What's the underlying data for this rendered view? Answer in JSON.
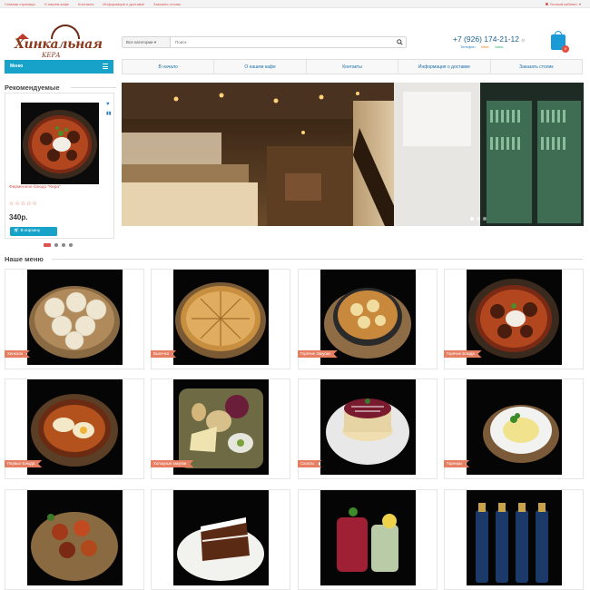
{
  "topbar": {
    "links": [
      "Главная страница",
      "О нашем кафе",
      "Контакты",
      "Информация о доставке",
      "Заказать столик"
    ],
    "account": "Личный кабинет"
  },
  "logo": {
    "wordmark": "Хинкальная",
    "subtitle": "КЕРА"
  },
  "search": {
    "category": "Все категории",
    "placeholder": "Поиск"
  },
  "contact": {
    "phone": "+7 (926) 174-21-12",
    "messengers": [
      "Телефон",
      "Viber",
      "Чаты"
    ]
  },
  "cart": {
    "count": "0"
  },
  "menu_button": {
    "label": "Меню"
  },
  "nav": [
    "В начало",
    "О нашем кафе",
    "Контакты",
    "Информация о доставке",
    "Заказать столик"
  ],
  "recommended": {
    "title": "Рекомендуемые",
    "product": {
      "name": "Фирменное блюдо \"Кера\"",
      "stars": "☆☆☆☆☆",
      "price": "340р.",
      "button": "В корзину"
    }
  },
  "menu": {
    "title": "Наше меню",
    "categories": [
      "Хинкали",
      "Выпечка",
      "Горячие Закуски",
      "Горячие Блюда",
      "Первые Блюда",
      "Холодные закуски",
      "Салаты",
      "Гарниры",
      "",
      "",
      "",
      ""
    ]
  },
  "colors": {
    "accent": "#17a2c9",
    "label": "#e67e62",
    "link": "#1a6ea8",
    "alert": "#d9534f"
  }
}
